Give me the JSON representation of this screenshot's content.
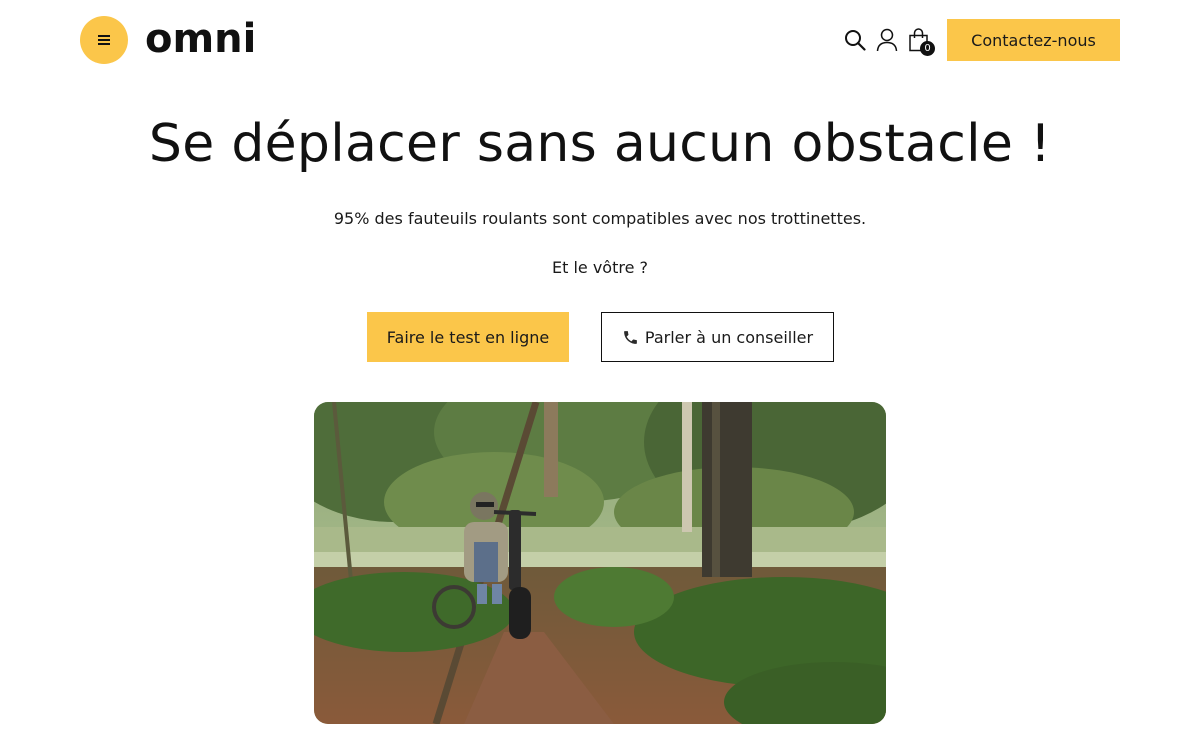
{
  "header": {
    "menu_icon": "hamburger-menu-icon",
    "logo_text": "omni",
    "search_icon": "search-icon",
    "account_icon": "user-icon",
    "cart_icon": "shopping-bag-icon",
    "cart_count": "0",
    "contact_label": "Contactez-nous",
    "accent_color": "#fbc64a"
  },
  "hero": {
    "title": "Se déplacer sans aucun obstacle !",
    "subtitle": "95% des fauteuils roulants sont compatibles avec nos trottinettes.",
    "question": "Et le vôtre ?",
    "primary_button": "Faire le test en ligne",
    "secondary_button": "Parler à un conseiller",
    "secondary_icon": "phone-icon"
  }
}
